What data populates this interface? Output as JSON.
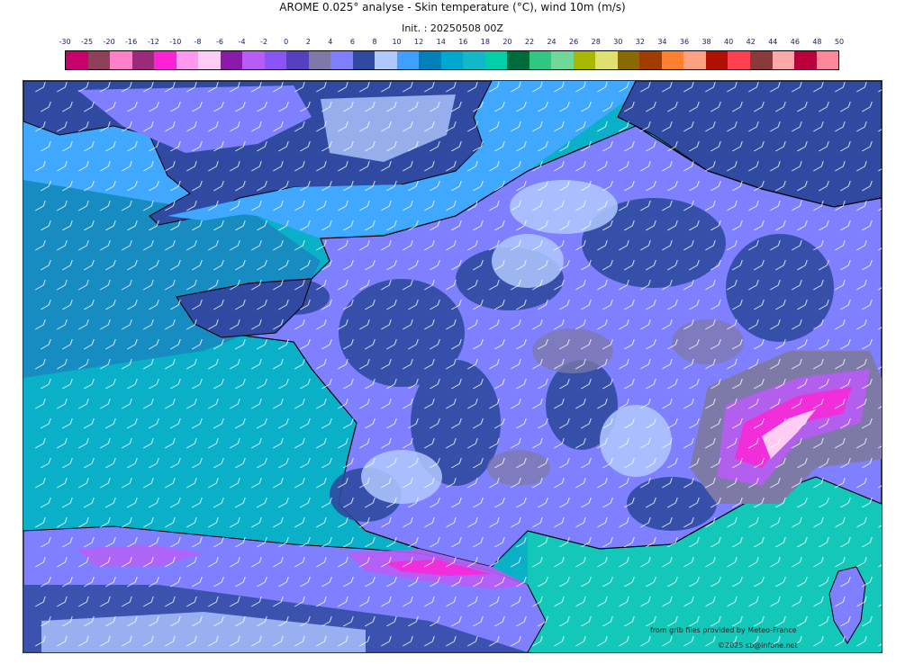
{
  "header": {
    "title": "AROME 0.025° analyse - Skin temperature (°C), wind 10m (m/s)",
    "init": "Init. : 20250508 00Z"
  },
  "colorbar": {
    "ticks": [
      "-30",
      "-25",
      "-20",
      "-16",
      "-12",
      "-10",
      "-8",
      "-6",
      "-4",
      "-2",
      "0",
      "2",
      "4",
      "6",
      "8",
      "10",
      "12",
      "14",
      "16",
      "18",
      "20",
      "22",
      "24",
      "26",
      "28",
      "30",
      "32",
      "34",
      "36",
      "38",
      "40",
      "42",
      "44",
      "46",
      "48",
      "50"
    ],
    "colors": [
      "#c7006b",
      "#8e3f5a",
      "#ff80c8",
      "#9b2a7a",
      "#ff22d4",
      "#ff99ee",
      "#ffccf4",
      "#8c1aa8",
      "#b95cf5",
      "#8a55f0",
      "#5540c0",
      "#7d7aa8",
      "#7f7fff",
      "#2f4aa0",
      "#b0c8ff",
      "#3fa0ff",
      "#0080b8",
      "#00a8d0",
      "#13b8c8",
      "#00d0a8",
      "#006b3a",
      "#30c880",
      "#70d898",
      "#a8b800",
      "#e0e070",
      "#8a6a00",
      "#a03c00",
      "#ff8030",
      "#ffa080",
      "#b01000",
      "#ff4050",
      "#8a3a3a",
      "#ffa8a8",
      "#b8003a",
      "#ff8898"
    ]
  },
  "credits": {
    "source": "from grib files provided by Meteo-France",
    "copyright": "©2025 sb@infone.net"
  },
  "map": {
    "region": "France",
    "colors": {
      "ocean_west": "#0ab0c8",
      "channel": "#40a8ff",
      "atlantic_deep": "#1888c0",
      "mediterranean": "#13c8b8",
      "land_base": "#7f80ff",
      "land_dark": "#2f4aa0",
      "land_light": "#b0c8ff",
      "land_grey": "#7d7aa8",
      "alps_violet": "#b95cf5",
      "alps_magenta": "#ff22d4",
      "alps_pink": "#ffccf4",
      "coastline": "#000000",
      "wind_barb": "#ffffff"
    }
  }
}
